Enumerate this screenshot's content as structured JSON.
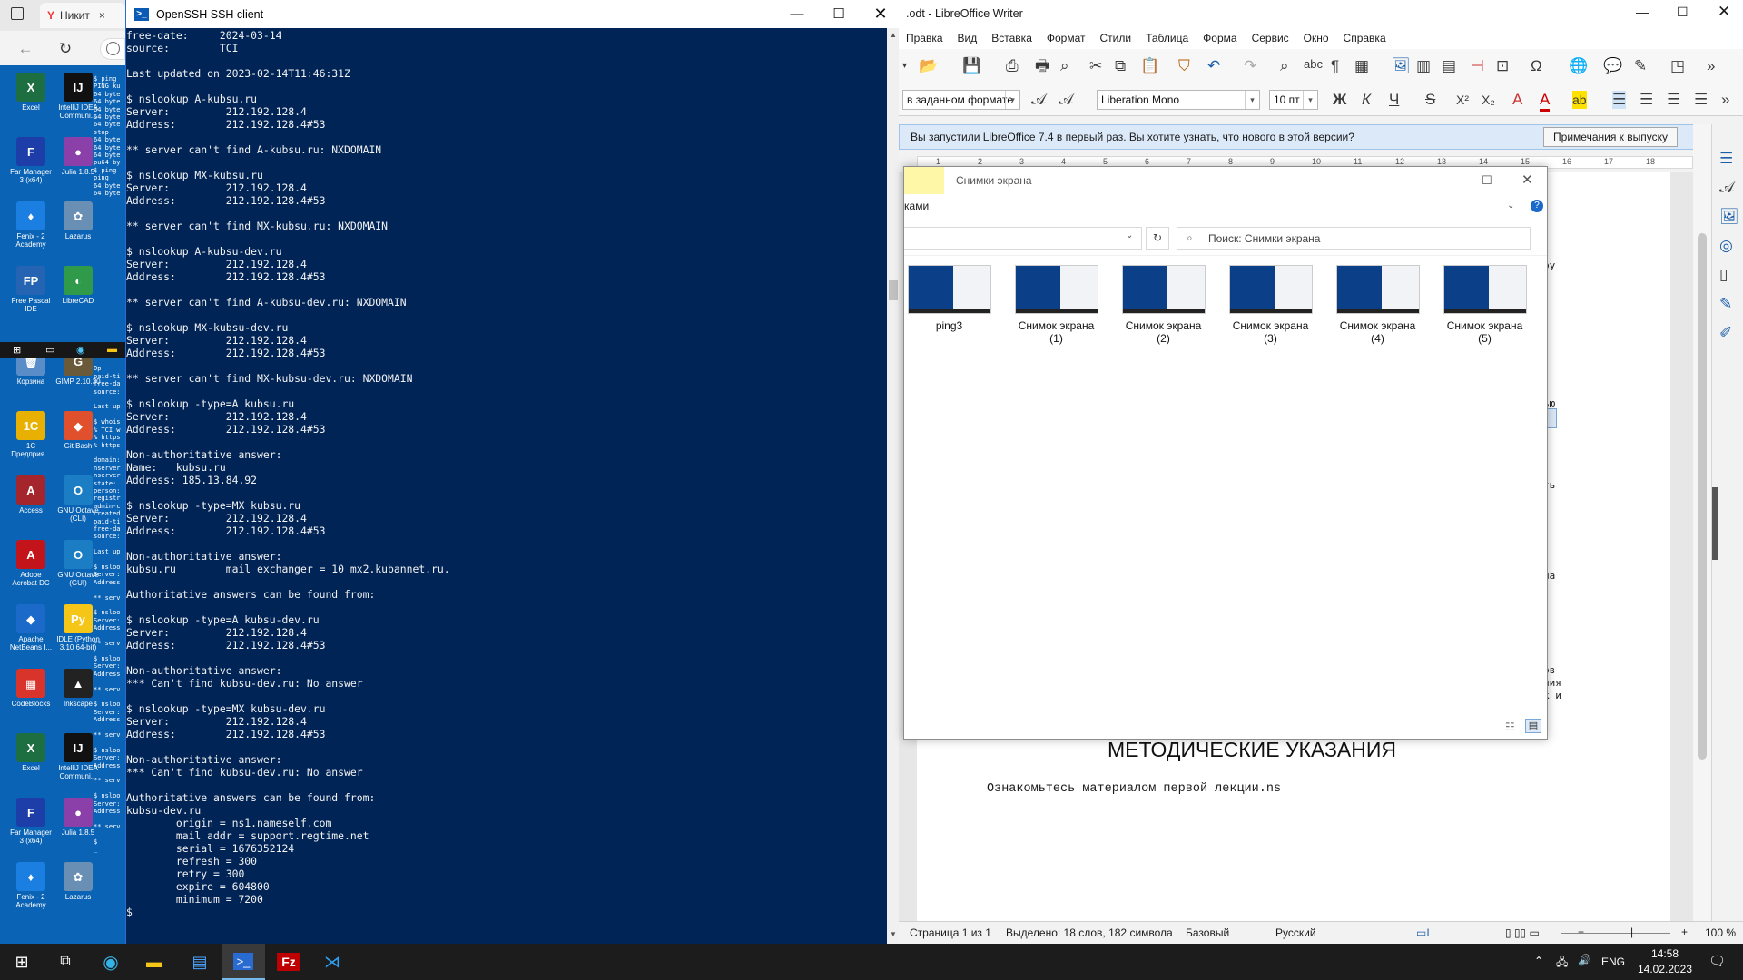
{
  "browser": {
    "tab_title": "Никит",
    "tab_close": "×"
  },
  "desktop_icons": [
    {
      "label": "Excel",
      "color": "#1d6f42",
      "glyph": "X"
    },
    {
      "label": "IntelliJ IDEA Communi...",
      "color": "#111",
      "glyph": "IJ"
    },
    {
      "label": "Far Manager 3 (x64)",
      "color": "#1d3ea8",
      "glyph": "F"
    },
    {
      "label": "Julia 1.8.5",
      "color": "#8b3fa8",
      "glyph": "●"
    },
    {
      "label": "Fenix - 2 Academy",
      "color": "#1a7fe0",
      "glyph": "♦"
    },
    {
      "label": "Lazarus",
      "color": "#6a8fb5",
      "glyph": "✿"
    },
    {
      "label": "Free Pascal IDE",
      "color": "#2563b3",
      "glyph": "FP"
    },
    {
      "label": "LibreCAD",
      "color": "#2e9a4a",
      "glyph": "◐"
    },
    {
      "label": "Корзина",
      "color": "#5a8cc8",
      "glyph": "🗑"
    },
    {
      "label": "GIMP 2.10.30",
      "color": "#6b5a3a",
      "glyph": "G"
    },
    {
      "label": "1С Предприя...",
      "color": "#e8b000",
      "glyph": "1С"
    },
    {
      "label": "Git Bash",
      "color": "#e0502c",
      "glyph": "◆"
    },
    {
      "label": "Access",
      "color": "#a4262c",
      "glyph": "A"
    },
    {
      "label": "GNU Octave (CLI)",
      "color": "#1b7ec4",
      "glyph": "O"
    },
    {
      "label": "Adobe Acrobat DC",
      "color": "#c4141b",
      "glyph": "A"
    },
    {
      "label": "GNU Octave (GUI)",
      "color": "#1b7ec4",
      "glyph": "O"
    },
    {
      "label": "Apache NetBeans I...",
      "color": "#1b6ac9",
      "glyph": "◆"
    },
    {
      "label": "IDLE (Python 3.10 64-bit)",
      "color": "#f5c518",
      "glyph": "Py"
    },
    {
      "label": "CodeBlocks",
      "color": "#d9342b",
      "glyph": "▦"
    },
    {
      "label": "Inkscape",
      "color": "#222",
      "glyph": "▲"
    },
    {
      "label": "Excel",
      "color": "#1d6f42",
      "glyph": "X"
    },
    {
      "label": "IntelliJ IDEA Communi...",
      "color": "#111",
      "glyph": "IJ"
    },
    {
      "label": "Far Manager 3 (x64)",
      "color": "#1d3ea8",
      "glyph": "F"
    },
    {
      "label": "Julia 1.8.5",
      "color": "#8b3fa8",
      "glyph": "●"
    },
    {
      "label": "Fenix - 2 Academy",
      "color": "#1a7fe0",
      "glyph": "♦"
    },
    {
      "label": "Lazarus",
      "color": "#6a8fb5",
      "glyph": "✿"
    }
  ],
  "mini_desktop_text": "$ ping\nPING ku\n64 byte\n64 byte\n64 byte\n64 byte\n64 byte\nstop\n64 byte\n64 byte\n64 byte\npu64 by\n$ ping\nping\n64 byte\n64 byte\n\n\n\n\n\n\n\n\n\n\n\n\n\n\n\n\n\n\n\n\n\n\nOp\npaid-ti\nfree-da\nsource:\n\nLast up\n\n$ whois\n% TCI w\n% https\n% https\n\ndomain:\nnserver\nnserver\nstate:\nperson:\nregistr\nadmin-c\ncreated\npaid-ti\nfree-da\nsource:\n\nLast up\n\n$ nsloo\nServer:\nAddress\n\n** serv\n\n$ nsloo\nServer:\nAddress\n\n** serv\n\n$ nsloo\nServer:\nAddress\n\n** serv\n\n$ nsloo\nServer:\nAddress\n\n** serv\n\n$ nsloo\nServer:\nAddress\n\n** serv\n\n$ nsloo\nServer:\nAddress\n\n** serv\n\n$\n_",
  "terminal": {
    "title": "OpenSSH SSH client",
    "lines": [
      "free-date:     2024-03-14",
      "source:        TCI",
      "",
      "Last updated on 2023-02-14T11:46:31Z",
      "",
      "$ nslookup A-kubsu.ru",
      "Server:         212.192.128.4",
      "Address:        212.192.128.4#53",
      "",
      "** server can't find A-kubsu.ru: NXDOMAIN",
      "",
      "$ nslookup MX-kubsu.ru",
      "Server:         212.192.128.4",
      "Address:        212.192.128.4#53",
      "",
      "** server can't find MX-kubsu.ru: NXDOMAIN",
      "",
      "$ nslookup A-kubsu-dev.ru",
      "Server:         212.192.128.4",
      "Address:        212.192.128.4#53",
      "",
      "** server can't find A-kubsu-dev.ru: NXDOMAIN",
      "",
      "$ nslookup MX-kubsu-dev.ru",
      "Server:         212.192.128.4",
      "Address:        212.192.128.4#53",
      "",
      "** server can't find MX-kubsu-dev.ru: NXDOMAIN",
      "",
      "$ nslookup -type=A kubsu.ru",
      "Server:         212.192.128.4",
      "Address:        212.192.128.4#53",
      "",
      "Non-authoritative answer:",
      "Name:   kubsu.ru",
      "Address: 185.13.84.92",
      "",
      "$ nslookup -type=MX kubsu.ru",
      "Server:         212.192.128.4",
      "Address:        212.192.128.4#53",
      "",
      "Non-authoritative answer:",
      "kubsu.ru        mail exchanger = 10 mx2.kubannet.ru.",
      "",
      "Authoritative answers can be found from:",
      "",
      "$ nslookup -type=A kubsu-dev.ru",
      "Server:         212.192.128.4",
      "Address:        212.192.128.4#53",
      "",
      "Non-authoritative answer:",
      "*** Can't find kubsu-dev.ru: No answer",
      "",
      "$ nslookup -type=MX kubsu-dev.ru",
      "Server:         212.192.128.4",
      "Address:        212.192.128.4#53",
      "",
      "Non-authoritative answer:",
      "*** Can't find kubsu-dev.ru: No answer",
      "",
      "Authoritative answers can be found from:",
      "kubsu-dev.ru",
      "        origin = ns1.nameself.com",
      "        mail addr = support.regtime.net",
      "        serial = 1676352124",
      "        refresh = 300",
      "        retry = 300",
      "        expire = 604800",
      "        minimum = 7200",
      "$"
    ]
  },
  "writer": {
    "title": ".odt - LibreOffice Writer",
    "menu": [
      "Правка",
      "Вид",
      "Вставка",
      "Формат",
      "Стили",
      "Таблица",
      "Форма",
      "Сервис",
      "Окно",
      "Справка"
    ],
    "para_style": "в заданном формате",
    "font_name": "Liberation Mono",
    "font_size": "10 пт",
    "fmt_bold": "Ж",
    "fmt_italic": "К",
    "fmt_underline": "Ч",
    "fmt_strike": "S",
    "info_text": "Вы запустили LibreOffice 7.4 в первый раз. Вы хотите узнать, что нового в этой версии?",
    "info_button": "Примечания к выпуску",
    "ruler_ticks": [
      "1",
      "2",
      "3",
      "4",
      "5",
      "6",
      "7",
      "8",
      "9",
      "10",
      "11",
      "12",
      "13",
      "14",
      "15",
      "16",
      "17",
      "18"
    ],
    "doc_heading": "МЕТОДИЧЕСКИЕ УКАЗАНИЯ",
    "doc_text": "Ознакомьтесь материалом первой лекции.ns",
    "edge_fragments": [
      "ру",
      "ью",
      "ть",
      "на",
      "ов",
      "ния",
      "к и"
    ],
    "status": {
      "page": "Страница 1 из 1",
      "selection": "Выделено: 18 слов, 182 символа",
      "style": "Базовый",
      "language": "Русский",
      "zoom": "100 %"
    }
  },
  "explorer": {
    "title": "Снимки экрана",
    "ribbon_tab": "ками",
    "search_placeholder": "Поиск: Снимки экрана",
    "files": [
      {
        "line1": "ping3",
        "line2": ""
      },
      {
        "line1": "Снимок экрана",
        "line2": "(1)"
      },
      {
        "line1": "Снимок экрана",
        "line2": "(2)"
      },
      {
        "line1": "Снимок экрана",
        "line2": "(3)"
      },
      {
        "line1": "Снимок экрана",
        "line2": "(4)"
      },
      {
        "line1": "Снимок экрана",
        "line2": "(5)"
      }
    ]
  },
  "taskbar": {
    "lang": "ENG",
    "time": "14:58",
    "date": "14.02.2023"
  }
}
